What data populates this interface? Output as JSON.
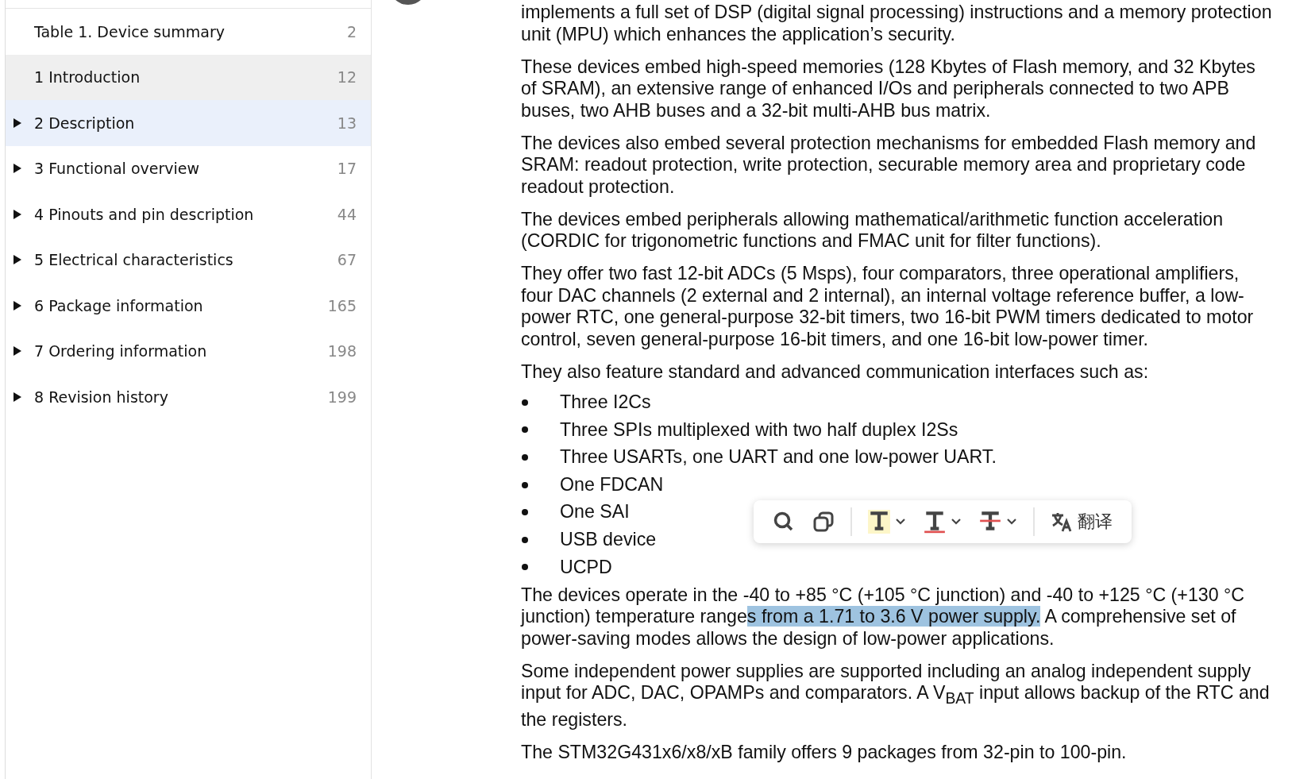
{
  "outline": {
    "items": [
      {
        "label": "Table 1. Device summary",
        "page": "2",
        "expandable": false,
        "selected": false,
        "hovered": false
      },
      {
        "label": "1 Introduction",
        "page": "12",
        "expandable": false,
        "selected": false,
        "hovered": true
      },
      {
        "label": "2 Description",
        "page": "13",
        "expandable": true,
        "selected": true,
        "hovered": false
      },
      {
        "label": "3 Functional overview",
        "page": "17",
        "expandable": true,
        "selected": false,
        "hovered": false
      },
      {
        "label": "4 Pinouts and pin description",
        "page": "44",
        "expandable": true,
        "selected": false,
        "hovered": false
      },
      {
        "label": "5 Electrical characteristics",
        "page": "67",
        "expandable": true,
        "selected": false,
        "hovered": false
      },
      {
        "label": "6 Package information",
        "page": "165",
        "expandable": true,
        "selected": false,
        "hovered": false
      },
      {
        "label": "7 Ordering information",
        "page": "198",
        "expandable": true,
        "selected": false,
        "hovered": false
      },
      {
        "label": "8 Revision history",
        "page": "199",
        "expandable": true,
        "selected": false,
        "hovered": false
      }
    ]
  },
  "document": {
    "blocks": [
      {
        "kind": "paragraph",
        "runs": [
          {
            "text": "implements a full set of DSP (digital signal processing) instructions and a memory protection unit (MPU) which enhances the application’s security.",
            "selected": false
          }
        ]
      },
      {
        "kind": "paragraph",
        "runs": [
          {
            "text": "These devices embed high-speed memories (128 Kbytes of Flash memory, and 32 Kbytes of SRAM), an extensive range of enhanced I/Os and peripherals connected to two APB buses, two AHB buses and a 32-bit multi-AHB bus matrix.",
            "selected": false
          }
        ]
      },
      {
        "kind": "paragraph",
        "runs": [
          {
            "text": "The devices also embed several protection mechanisms for embedded Flash memory and SRAM: readout protection, write protection, securable memory area and proprietary code readout protection.",
            "selected": false
          }
        ]
      },
      {
        "kind": "paragraph",
        "runs": [
          {
            "text": "The devices embed peripherals allowing mathematical/arithmetic function acceleration (CORDIC for trigonometric functions and FMAC unit for filter functions).",
            "selected": false
          }
        ]
      },
      {
        "kind": "paragraph",
        "runs": [
          {
            "text": "They offer two fast 12-bit ADCs (5 Msps), four comparators, three operational amplifiers, four DAC channels (2 external and 2 internal), an internal voltage reference buffer, a low-power RTC, one general-purpose 32-bit timers, two 16-bit PWM timers dedicated to motor control, seven general-purpose 16-bit timers, and one 16-bit low-power timer.",
            "selected": false
          }
        ]
      },
      {
        "kind": "paragraph",
        "runs": [
          {
            "text": "They also feature standard and advanced communication interfaces such as:",
            "selected": false
          }
        ]
      },
      {
        "kind": "bullets",
        "items": [
          "Three I2Cs",
          "Three SPIs multiplexed with two half duplex I2Ss",
          "Three USARTs, one UART and one low-power UART.",
          "One FDCAN",
          "One SAI",
          "USB device",
          "UCPD"
        ]
      },
      {
        "kind": "paragraph",
        "runs": [
          {
            "text": "The devices operate in the -40 to +85 °C (+105 °C junction) and -40 to +125 °C (+130 °C junction) temperature range",
            "selected": false
          },
          {
            "text": "s from a 1.71 to 3.6 V power supply.",
            "selected": true
          },
          {
            "text": " A comprehensive set of power-saving modes allows the design of low-power applications.",
            "selected": false
          }
        ]
      },
      {
        "kind": "paragraph",
        "runs": [
          {
            "text": "Some independent power supplies are supported including an analog independent supply input for ADC, DAC, OPAMPs and comparators. A V$_{BAT}$ input allows backup of the RTC and the registers.",
            "selected": false
          }
        ]
      },
      {
        "kind": "paragraph",
        "runs": [
          {
            "text": "The STM32G431x6/x8/xB family offers 9 packages from 32-pin to 100-pin.",
            "selected": false
          }
        ]
      }
    ]
  },
  "selection_toolbar": {
    "tools": [
      {
        "kind": "search"
      },
      {
        "kind": "copy"
      },
      {
        "kind": "divider"
      },
      {
        "kind": "highlight"
      },
      {
        "kind": "underline"
      },
      {
        "kind": "strike"
      },
      {
        "kind": "divider"
      },
      {
        "kind": "translate",
        "label": "翻译"
      }
    ]
  }
}
